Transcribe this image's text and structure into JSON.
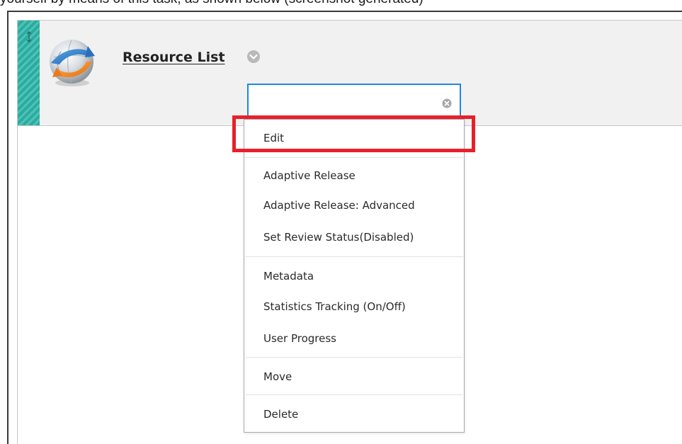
{
  "caption": {
    "text": "yourself by means of this task, as shown below (screenshot generated)"
  },
  "item": {
    "title": "Resource List",
    "icon": "globe-arrows-icon",
    "handle_icon": "vertical-arrows-icon",
    "accent_color": "#2bb3a6"
  },
  "search": {
    "value": "",
    "placeholder": "",
    "clear_icon": "clear-circle-x-icon"
  },
  "menu": {
    "items": [
      "Edit",
      "Adaptive Release",
      "Adaptive Release: Advanced",
      "Set Review Status(Disabled)",
      "Metadata",
      "Statistics Tracking (On/Off)",
      "User Progress",
      "Move",
      "Delete"
    ],
    "highlighted": "Edit",
    "highlight_color": "#e8202a"
  }
}
